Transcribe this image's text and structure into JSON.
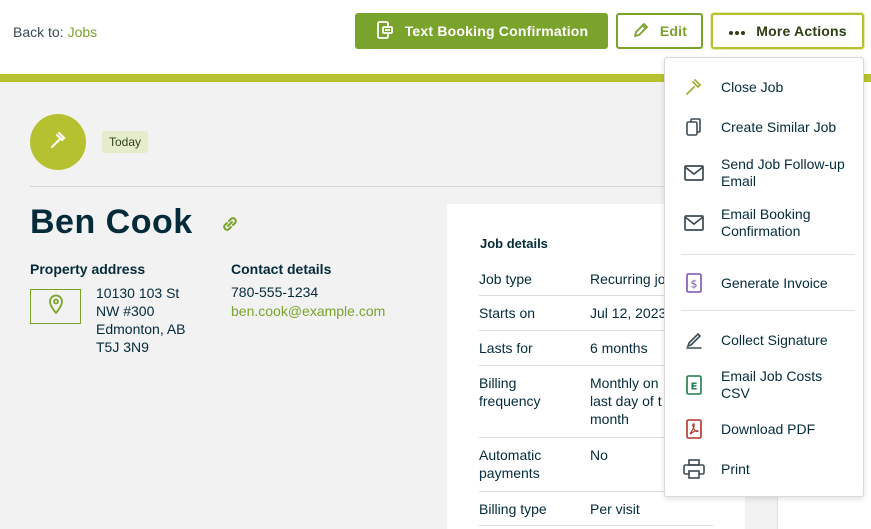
{
  "nav": {
    "back_prefix": "Back to:",
    "back_link": "Jobs"
  },
  "toolbar": {
    "text_booking": "Text Booking Confirmation",
    "edit": "Edit",
    "more_actions": "More Actions"
  },
  "job": {
    "date_badge": "Today",
    "client_name": "Ben Cook",
    "property_label": "Property address",
    "address": "10130 103 St NW #300 Edmonton, AB T5J 3N9",
    "contact_label": "Contact details",
    "phone": "780-555-1234",
    "email": "ben.cook@example.com"
  },
  "details": {
    "title": "Job details",
    "rows": [
      {
        "key": "Job type",
        "value": "Recurring jo"
      },
      {
        "key": "Starts on",
        "value": "Jul 12, 2023"
      },
      {
        "key": "Lasts for",
        "value": "6 months"
      },
      {
        "key": "Billing frequency",
        "value": "Monthly on last day of t month"
      },
      {
        "key": "Automatic payments",
        "value": "No"
      },
      {
        "key": "Billing type",
        "value": "Per visit"
      }
    ]
  },
  "menu": {
    "items": [
      {
        "label": "Close Job",
        "icon": "hammer-icon"
      },
      {
        "label": "Create Similar Job",
        "icon": "copy-icon"
      },
      {
        "label": "Send Job Follow-up Email",
        "icon": "mail-icon"
      },
      {
        "label": "Email Booking Confirmation",
        "icon": "mail-icon"
      },
      {
        "label": "Generate Invoice",
        "icon": "invoice-icon"
      },
      {
        "label": "Collect Signature",
        "icon": "pen-icon"
      },
      {
        "label": "Email Job Costs CSV",
        "icon": "csv-file-icon"
      },
      {
        "label": "Download PDF",
        "icon": "pdf-file-icon"
      },
      {
        "label": "Print",
        "icon": "printer-icon"
      }
    ]
  },
  "colors": {
    "brand_green": "#7aa32b",
    "accent_lime": "#b6c12f",
    "navy_text": "#032b3a",
    "invoice_purple": "#7b4fb3",
    "csv_green": "#1f7a4a",
    "pdf_red": "#b0322a"
  }
}
